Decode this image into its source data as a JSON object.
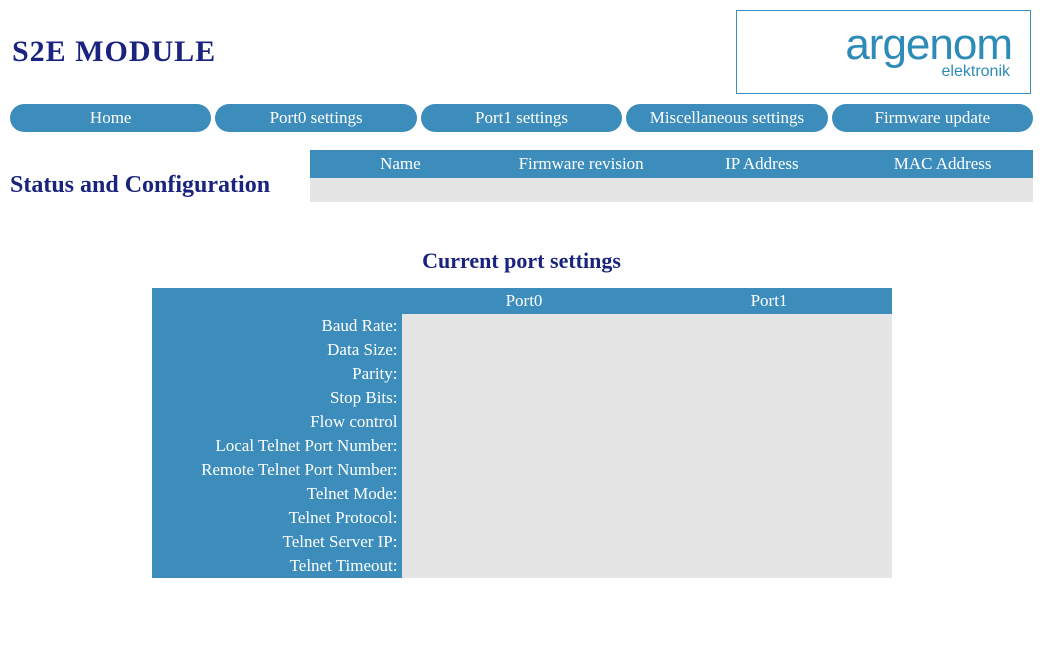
{
  "header": {
    "title": "S2E MODULE",
    "logo_main": "argenom",
    "logo_sub": "elektronik"
  },
  "nav": [
    "Home",
    "Port0 settings",
    "Port1 settings",
    "Miscellaneous settings",
    "Firmware update"
  ],
  "status": {
    "heading": "Status and Configuration",
    "columns": [
      "Name",
      "Firmware revision",
      "IP Address",
      "MAC Address"
    ],
    "values": [
      "",
      "",
      "",
      ""
    ]
  },
  "port_section": {
    "title": "Current port settings",
    "columns": [
      "",
      "Port0",
      "Port1"
    ],
    "rows": [
      {
        "label": "Baud Rate:",
        "p0": "",
        "p1": ""
      },
      {
        "label": "Data Size:",
        "p0": "",
        "p1": ""
      },
      {
        "label": "Parity:",
        "p0": "",
        "p1": ""
      },
      {
        "label": "Stop Bits:",
        "p0": "",
        "p1": ""
      },
      {
        "label": "Flow control",
        "p0": "",
        "p1": ""
      },
      {
        "label": "Local Telnet Port Number:",
        "p0": "",
        "p1": ""
      },
      {
        "label": "Remote Telnet Port Number:",
        "p0": "",
        "p1": ""
      },
      {
        "label": "Telnet Mode:",
        "p0": "",
        "p1": ""
      },
      {
        "label": "Telnet Protocol:",
        "p0": "",
        "p1": ""
      },
      {
        "label": "Telnet Server IP:",
        "p0": "",
        "p1": ""
      },
      {
        "label": "Telnet Timeout:",
        "p0": "",
        "p1": ""
      }
    ]
  }
}
